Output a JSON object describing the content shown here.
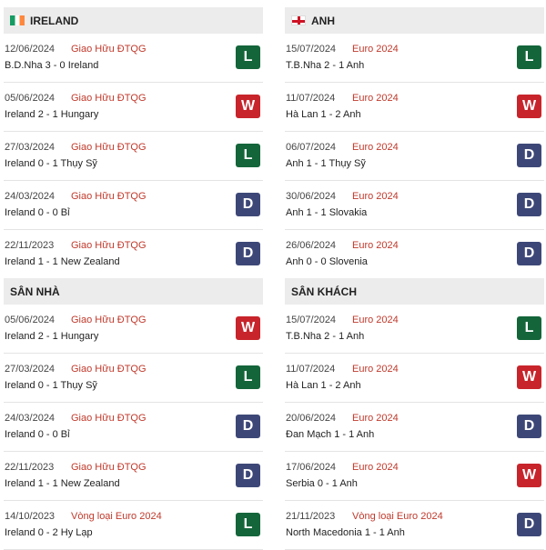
{
  "colors": {
    "win": "#c8242b",
    "loss": "#14653a",
    "draw": "#3d4777",
    "competition": "#c0392b"
  },
  "ireland_recent": {
    "title": "IRELAND",
    "flag_icon": "ireland-flag-icon",
    "matches": [
      {
        "date": "12/06/2024",
        "competition": "Giao Hữu ĐTQG",
        "score": "B.D.Nha 3 - 0 Ireland",
        "result": "L"
      },
      {
        "date": "05/06/2024",
        "competition": "Giao Hữu ĐTQG",
        "score": "Ireland 2 - 1 Hungary",
        "result": "W"
      },
      {
        "date": "27/03/2024",
        "competition": "Giao Hữu ĐTQG",
        "score": "Ireland 0 - 1 Thụy Sỹ",
        "result": "L"
      },
      {
        "date": "24/03/2024",
        "competition": "Giao Hữu ĐTQG",
        "score": "Ireland 0 - 0 Bỉ",
        "result": "D"
      },
      {
        "date": "22/11/2023",
        "competition": "Giao Hữu ĐTQG",
        "score": "Ireland 1 - 1 New Zealand",
        "result": "D"
      }
    ]
  },
  "england_recent": {
    "title": "ANH",
    "flag_icon": "england-flag-icon",
    "matches": [
      {
        "date": "15/07/2024",
        "competition": "Euro 2024",
        "score": "T.B.Nha 2 - 1 Anh",
        "result": "L"
      },
      {
        "date": "11/07/2024",
        "competition": "Euro 2024",
        "score": "Hà Lan 1 - 2 Anh",
        "result": "W"
      },
      {
        "date": "06/07/2024",
        "competition": "Euro 2024",
        "score": "Anh 1 - 1 Thụy Sỹ",
        "result": "D"
      },
      {
        "date": "30/06/2024",
        "competition": "Euro 2024",
        "score": "Anh 1 - 1 Slovakia",
        "result": "D"
      },
      {
        "date": "26/06/2024",
        "competition": "Euro 2024",
        "score": "Anh 0 - 0 Slovenia",
        "result": "D"
      }
    ]
  },
  "ireland_home": {
    "title": "SÂN NHÀ",
    "matches": [
      {
        "date": "05/06/2024",
        "competition": "Giao Hữu ĐTQG",
        "score": "Ireland 2 - 1 Hungary",
        "result": "W"
      },
      {
        "date": "27/03/2024",
        "competition": "Giao Hữu ĐTQG",
        "score": "Ireland 0 - 1 Thụy Sỹ",
        "result": "L"
      },
      {
        "date": "24/03/2024",
        "competition": "Giao Hữu ĐTQG",
        "score": "Ireland 0 - 0 Bỉ",
        "result": "D"
      },
      {
        "date": "22/11/2023",
        "competition": "Giao Hữu ĐTQG",
        "score": "Ireland 1 - 1 New Zealand",
        "result": "D"
      },
      {
        "date": "14/10/2023",
        "competition": "Vòng loại Euro 2024",
        "score": "Ireland 0 - 2 Hy Lạp",
        "result": "L"
      }
    ]
  },
  "england_away": {
    "title": "SÂN KHÁCH",
    "matches": [
      {
        "date": "15/07/2024",
        "competition": "Euro 2024",
        "score": "T.B.Nha 2 - 1 Anh",
        "result": "L"
      },
      {
        "date": "11/07/2024",
        "competition": "Euro 2024",
        "score": "Hà Lan 1 - 2 Anh",
        "result": "W"
      },
      {
        "date": "20/06/2024",
        "competition": "Euro 2024",
        "score": "Đan Mạch 1 - 1 Anh",
        "result": "D"
      },
      {
        "date": "17/06/2024",
        "competition": "Euro 2024",
        "score": "Serbia 0 - 1 Anh",
        "result": "W"
      },
      {
        "date": "21/11/2023",
        "competition": "Vòng loại Euro 2024",
        "score": "North Macedonia 1 - 1 Anh",
        "result": "D"
      }
    ]
  }
}
